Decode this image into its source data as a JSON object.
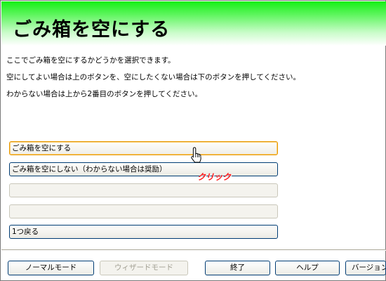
{
  "header": {
    "title": "ごみ箱を空にする",
    "gradient_color": "#16f016"
  },
  "description": {
    "line1": "ここでごみ箱を空にするかどうかを選択できます。",
    "line2": "空にしてよい場合は上のボタンを、空にしたくない場合は下のボタンを押してください。",
    "line3": "わからない場合は上から2番目のボタンを押してください。"
  },
  "choices": [
    {
      "label": "ごみ箱を空にする",
      "state": "hover"
    },
    {
      "label": "ごみ箱を空にしない（わからない場合は奨励）",
      "state": "enabled"
    },
    {
      "label": "",
      "state": "disabled"
    },
    {
      "label": "",
      "state": "disabled"
    },
    {
      "label": "1つ戻る",
      "state": "enabled"
    }
  ],
  "annotation": {
    "click_label": "クリック",
    "color": "#ff1a1a"
  },
  "bottom_bar": {
    "normal_mode": "ノーマルモード",
    "wizard_mode": "ウィザードモード",
    "exit": "終了",
    "help": "ヘルプ",
    "version": "バージョン"
  }
}
